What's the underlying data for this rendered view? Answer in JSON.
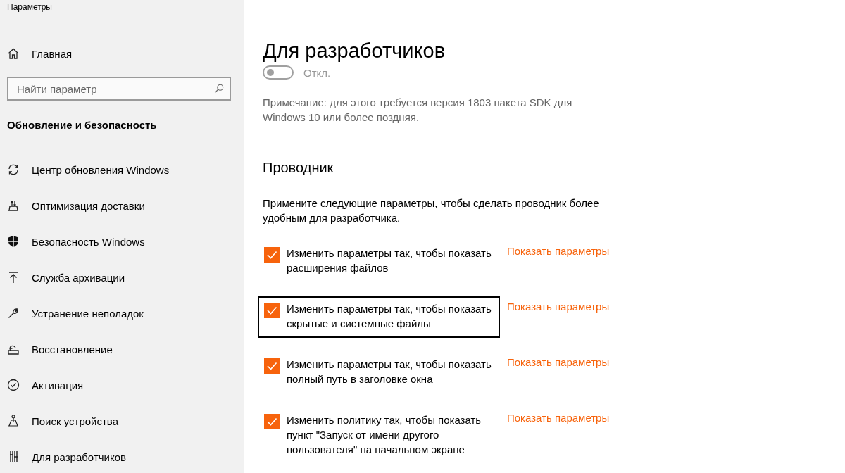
{
  "window": {
    "title": "Параметры"
  },
  "sidebar": {
    "home": "Главная",
    "search": {
      "placeholder": "Найти параметр"
    },
    "section": "Обновление и безопасность",
    "items": [
      {
        "label": "Центр обновления Windows",
        "selected": false
      },
      {
        "label": "Оптимизация доставки",
        "selected": false
      },
      {
        "label": "Безопасность Windows",
        "selected": false
      },
      {
        "label": "Служба архивации",
        "selected": false
      },
      {
        "label": "Устранение неполадок",
        "selected": false
      },
      {
        "label": "Восстановление",
        "selected": false
      },
      {
        "label": "Активация",
        "selected": false
      },
      {
        "label": "Поиск устройства",
        "selected": false
      },
      {
        "label": "Для разработчиков",
        "selected": false
      }
    ]
  },
  "page": {
    "title": "Для разработчиков",
    "toggle": {
      "on": false,
      "label": "Откл."
    },
    "note": "Примечание: для этого требуется версия 1803 пакета SDK для Windows 10 или более поздняя.",
    "section": "Проводник",
    "description": "Примените следующие параметры, чтобы сделать проводник более удобным для разработчика.",
    "options": [
      {
        "label": "Изменить параметры так, чтобы показать расширения файлов",
        "checked": true,
        "focused": false,
        "link": "Показать параметры"
      },
      {
        "label": "Изменить параметры так, чтобы показать скрытые и системные файлы",
        "checked": true,
        "focused": true,
        "link": "Показать параметры"
      },
      {
        "label": "Изменить параметры так, чтобы показать полный путь в заголовке окна",
        "checked": true,
        "focused": false,
        "link": "Показать параметры"
      },
      {
        "label": "Изменить политику так, чтобы показать пункт \"Запуск от имени другого пользователя\" на начальном экране",
        "checked": true,
        "focused": false,
        "link": "Показать параметры"
      }
    ]
  }
}
